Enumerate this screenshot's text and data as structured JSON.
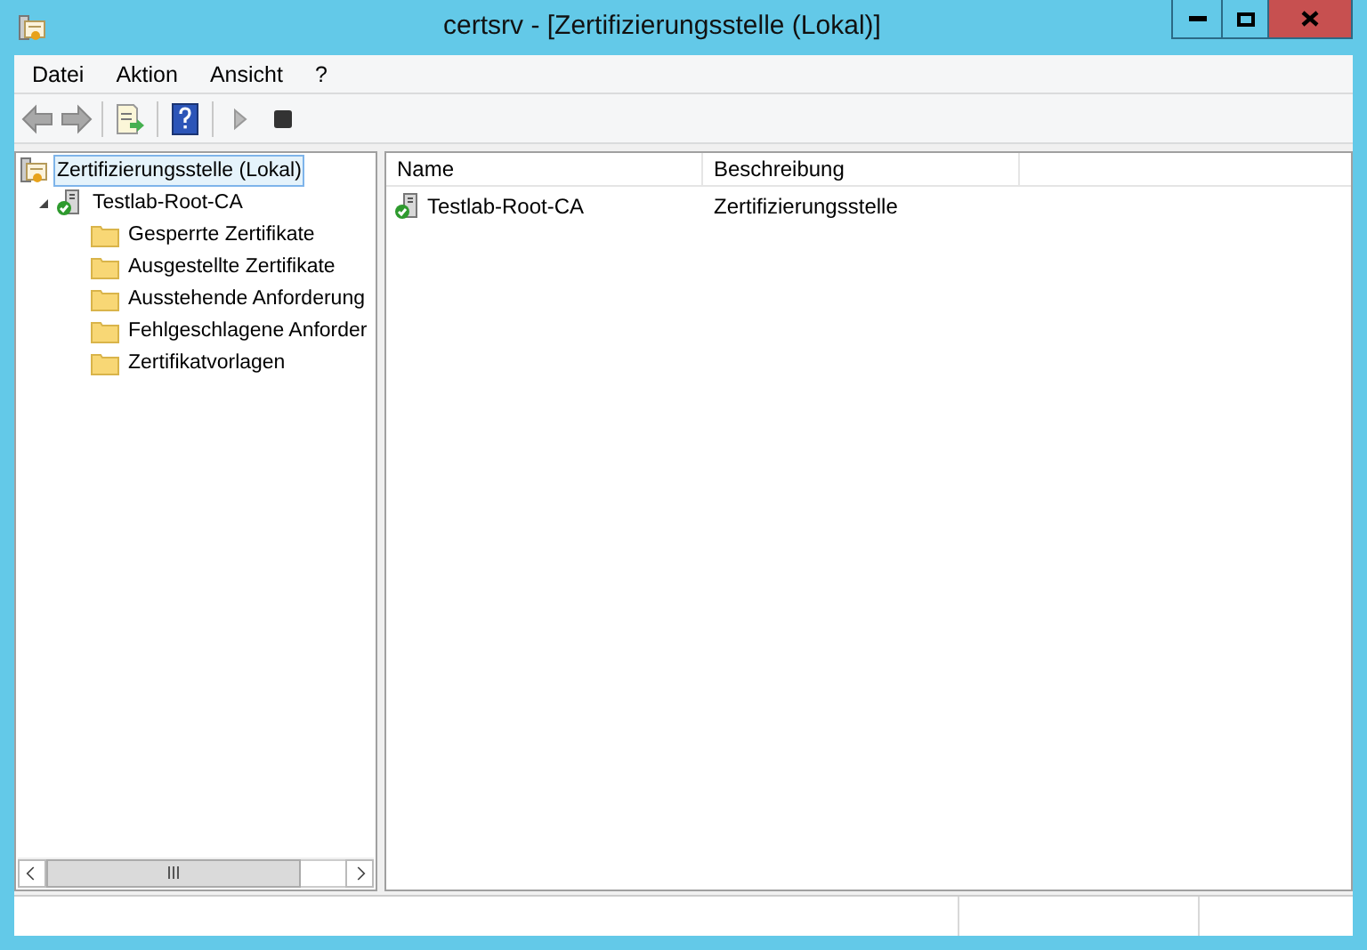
{
  "window": {
    "title": "certsrv - [Zertifizierungsstelle (Lokal)]"
  },
  "menu": [
    {
      "label": "Datei"
    },
    {
      "label": "Aktion"
    },
    {
      "label": "Ansicht"
    },
    {
      "label": "?"
    }
  ],
  "toolbar": [
    {
      "kind": "back",
      "disabled": true
    },
    {
      "kind": "forward",
      "disabled": true
    },
    {
      "kind": "separator"
    },
    {
      "kind": "export",
      "disabled": false
    },
    {
      "kind": "separator"
    },
    {
      "kind": "help",
      "disabled": false
    },
    {
      "kind": "separator"
    },
    {
      "kind": "play",
      "disabled": true
    },
    {
      "kind": "stop",
      "disabled": false
    }
  ],
  "tree": [
    {
      "label": "Zertifizierungsstelle (Lokal)",
      "kind": "root",
      "selected": true,
      "children": [
        {
          "label": "Testlab-Root-CA",
          "kind": "ca",
          "selected": false,
          "expanded": true,
          "children": [
            {
              "label": "Gesperrte Zertifikate",
              "kind": "folder",
              "selected": false
            },
            {
              "label": "Ausgestellte Zertifikate",
              "kind": "folder",
              "selected": false
            },
            {
              "label": "Ausstehende Anforderung",
              "kind": "folder",
              "selected": false
            },
            {
              "label": "Fehlgeschlagene Anforder",
              "kind": "folder",
              "selected": false
            },
            {
              "label": "Zertifikatvorlagen",
              "kind": "folder",
              "selected": false
            }
          ]
        }
      ]
    }
  ],
  "table": {
    "columns": [
      "Name",
      "Beschreibung"
    ],
    "rows": [
      {
        "name": "Testlab-Root-CA",
        "description": "Zertifizierungsstelle"
      }
    ]
  }
}
